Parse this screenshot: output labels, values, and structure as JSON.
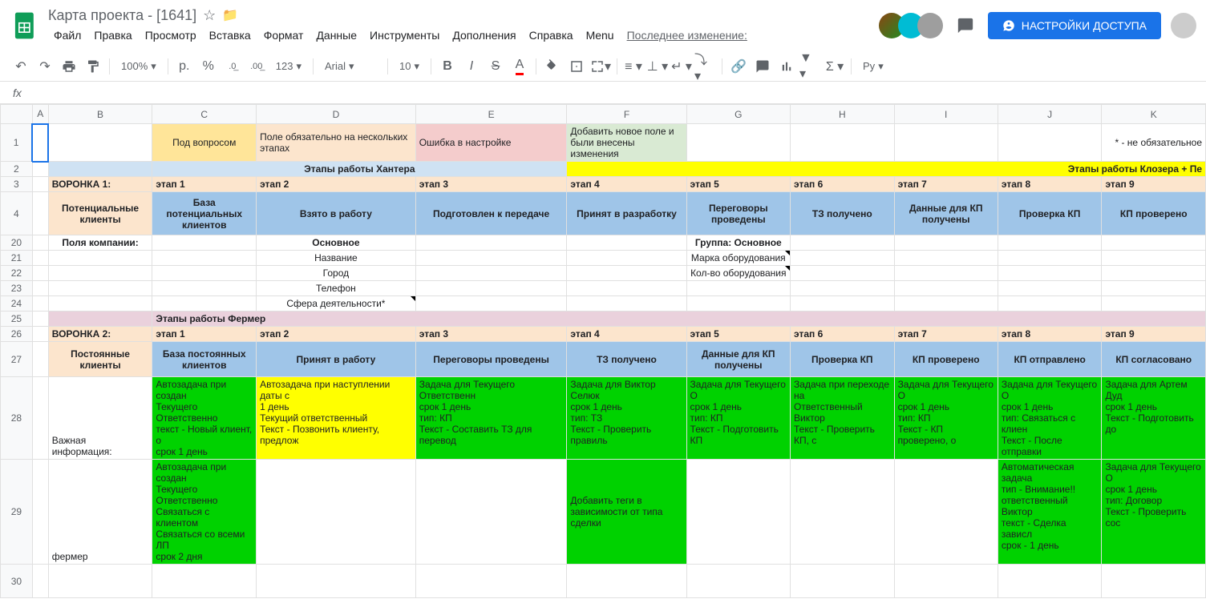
{
  "header": {
    "doc_title": "Карта проекта - [1641]",
    "last_edit_label": "Последнее изменение:",
    "share_label": "НАСТРОЙКИ ДОСТУПА"
  },
  "menu": [
    "Файл",
    "Правка",
    "Просмотр",
    "Вставка",
    "Формат",
    "Данные",
    "Инструменты",
    "Дополнения",
    "Справка",
    "Menu"
  ],
  "toolbar": {
    "zoom": "100%",
    "currency_symbol": "р.",
    "percent": "%",
    "dec_dec": ".0",
    "inc_dec": ".00",
    "format_123": "123",
    "font": "Arial",
    "font_size": "10",
    "lang": "Ру"
  },
  "formula_bar": {
    "fx_label": "fx"
  },
  "columns": [
    "A",
    "B",
    "C",
    "D",
    "E",
    "F",
    "G",
    "H",
    "I",
    "J",
    "K"
  ],
  "rows": [
    1,
    2,
    3,
    4,
    20,
    21,
    22,
    23,
    24,
    25,
    26,
    27,
    28,
    29,
    30
  ],
  "cells": {
    "r1_C": "Под вопросом",
    "r1_D": "Поле обязательно на нескольких этапах",
    "r1_E": "Ошибка в настройке",
    "r1_F": "Добавить новое поле и были внесены изменения",
    "r1_K": "* - не обязательное",
    "r2_left": "Этапы работы Хантера",
    "r2_right": "Этапы работы Клозера + Пе",
    "r3_B": "ВОРОНКА 1:",
    "r3_C": "этап 1",
    "r3_D": "этап 2",
    "r3_E": "этап 3",
    "r3_F": "этап 4",
    "r3_G": "этап 5",
    "r3_H": "этап 6",
    "r3_I": "этап 7",
    "r3_J": "этап 8",
    "r3_K": "этап 9",
    "r4_B": "Потенциальные клиенты",
    "r4_C": "База потенциальных клиентов",
    "r4_D": "Взято в работу",
    "r4_E": "Подготовлен к передаче",
    "r4_F": "Принят в разработку",
    "r4_G": "Переговоры проведены",
    "r4_H": "ТЗ получено",
    "r4_I": "Данные для КП получены",
    "r4_J": "Проверка КП",
    "r4_K": "КП проверено",
    "r20_B": "Поля компании:",
    "r20_D": "Основное",
    "r20_G": "Группа: Основное",
    "r21_D": "Название",
    "r21_G": "Марка оборудования",
    "r22_D": "Город",
    "r22_G": "Кол-во оборудования",
    "r23_D": "Телефон",
    "r24_D": "Сфера деятельности*",
    "r25_C": "Этапы работы Фермер",
    "r26_B": "ВОРОНКА 2:",
    "r26_C": "этап 1",
    "r26_D": "этап 2",
    "r26_E": "этап 3",
    "r26_F": "этап 4",
    "r26_G": "этап 5",
    "r26_H": "этап 6",
    "r26_I": "этап 7",
    "r26_J": "этап 8",
    "r26_K": "этап 9",
    "r27_B": "Постоянные клиенты",
    "r27_C": "База постоянных клиентов",
    "r27_D": "Принят в работу",
    "r27_E": "Переговоры проведены",
    "r27_F": "ТЗ получено",
    "r27_G": "Данные для КП получены",
    "r27_H": "Проверка КП",
    "r27_I": "КП проверено",
    "r27_J": "КП отправлено",
    "r27_K": "КП согласовано",
    "r28_B": "Важная информация:",
    "r28_C": "Автозадача при создан\nТекущего Ответственно\nтекст - Новый клиент, о\nсрок 1 день",
    "r28_D": "Автозадача при наступлении даты с\n1 день\nТекущий ответственный\nТекст - Позвонить клиенту, предлож",
    "r28_E": "Задача для Текущего Ответственн\nсрок 1 день\nтип: КП\nТекст - Составить ТЗ для перевод",
    "r28_F": "Задача для Виктор Селюк\nсрок 1 день\nтип: ТЗ\nТекст - Проверить правиль",
    "r28_G": "Задача для Текущего О\nсрок 1 день\nтип: КП\nТекст - Подготовить КП",
    "r28_H": "Задача при переходе на\nОтветственный Виктор\nТекст - Проверить КП, с",
    "r28_I": "Задача для Текущего О\nсрок 1 день\nтип: КП\nТекст - КП проверено, о",
    "r28_J": "Задача для Текущего О\nсрок 1 день\nтип: Связаться с клиен\nТекст - После отправки",
    "r28_K": "Задача для Артем Дуд\nсрок 1 день\nТекст - Подготовить до",
    "r29_B": "фермер",
    "r29_C": "Автозадача при создан\nТекущего Ответственно\nСвязаться с клиентом\nСвязаться со всеми ЛП\nсрок 2 дня",
    "r29_F": "Добавить теги в зависимости от типа сделки",
    "r29_J": "Автоматическая задача\nтип - Внимание!!\nответственный Виктор\nтекст -  Сделка зависл\nсрок - 1 день",
    "r29_K": "Задача для Текущего О\nсрок 1 день\nтип: Договор\nТекст - Проверить сос"
  },
  "colors": {
    "accent": "#1a73e8",
    "green": "#00d200",
    "yellow": "#ffff00",
    "blue_header": "#9fc5e8"
  }
}
